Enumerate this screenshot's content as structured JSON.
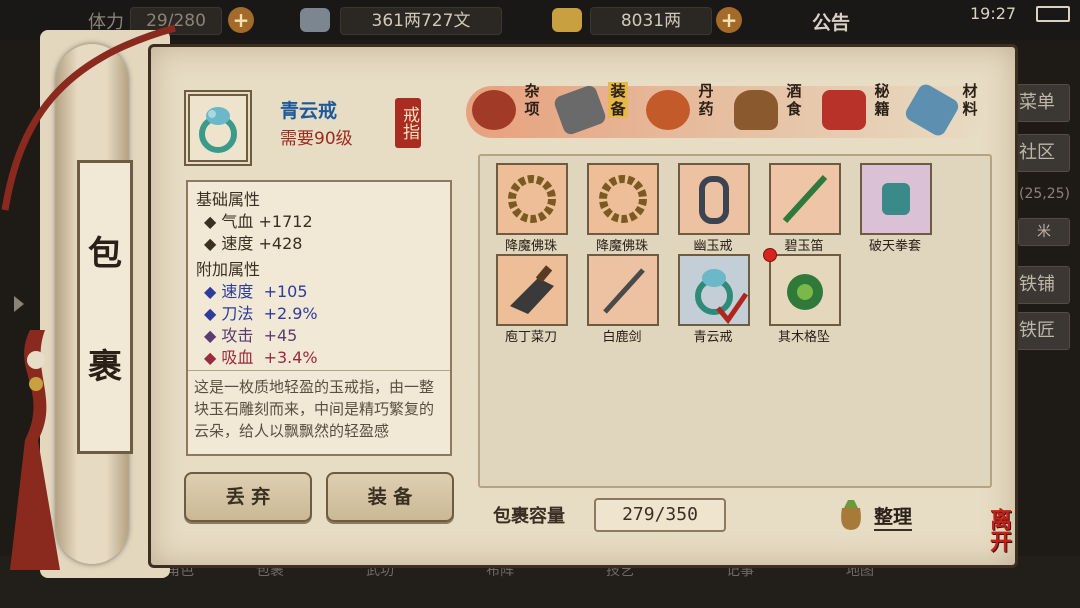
{
  "topbar": {
    "stamina": "29/280",
    "money_silver": "361两727文",
    "gold": "8031两",
    "notice": "公告",
    "time": "19:27"
  },
  "side_menu": [
    "菜单",
    "社区",
    "(25,25)",
    "米",
    "铁铺",
    "铁匠"
  ],
  "bottom_bar": [
    "角色",
    "包裹",
    "武功",
    "布阵",
    "技艺",
    "记事",
    "",
    "地图",
    ""
  ],
  "scroll_title": [
    "包",
    "裹"
  ],
  "selected_item": {
    "name": "青云戒",
    "requirement": "需要90级",
    "type_stamp": "戒指",
    "base_title": "基础属性",
    "base_attrs": [
      {
        "label": "气血",
        "value": "+1712"
      },
      {
        "label": "速度",
        "value": "+428"
      }
    ],
    "extra_title": "附加属性",
    "extra_attrs": [
      {
        "label": "速度",
        "value": "+105",
        "color": "#2d3c9a"
      },
      {
        "label": "刀法",
        "value": "+2.9%",
        "color": "#2d3c9a"
      },
      {
        "label": "攻击",
        "value": "+45",
        "color": "#5a3c72"
      },
      {
        "label": "吸血",
        "value": "+3.4%",
        "color": "#9a2b3e"
      }
    ],
    "description": "这是一枚质地轻盈的玉戒指，由一整块玉石雕刻而来，中间是精巧繁复的云朵，给人以飘飘然的轻盈感"
  },
  "buttons": {
    "discard": "丢 弃",
    "equip": "装 备",
    "sort": "整理"
  },
  "tabs": [
    {
      "label": "杂项",
      "color": "#a13a26"
    },
    {
      "label": "装备",
      "color": "#6a6a6a"
    },
    {
      "label": "丹药",
      "color": "#c25a2a"
    },
    {
      "label": "酒食",
      "color": "#8a5a2e"
    },
    {
      "label": "秘籍",
      "color": "#b8322a"
    },
    {
      "label": "材料",
      "color": "#5d8fb0"
    }
  ],
  "items": [
    {
      "name": "降魔佛珠",
      "color": "#7a5a20",
      "bg": "#e89a66"
    },
    {
      "name": "降魔佛珠",
      "color": "#7a5a20",
      "bg": "#e89a66"
    },
    {
      "name": "幽玉戒",
      "color": "#3b4450",
      "bg": "#e8a27a"
    },
    {
      "name": "碧玉笛",
      "color": "#2f7a3a",
      "bg": "#eaa882"
    },
    {
      "name": "破天拳套",
      "color": "#3a8a8a",
      "bg": "#c9a6d8"
    },
    {
      "name": "庖丁菜刀",
      "color": "#3a3a3a",
      "bg": "#e89a66"
    },
    {
      "name": "白鹿剑",
      "color": "#4a4a4a",
      "bg": "#e8a27a"
    },
    {
      "name": "青云戒",
      "color": "#2f8a7a",
      "bg": "#9ab8d8"
    },
    {
      "name": "其木格坠",
      "color": "#2f7a3a",
      "bg": "#d8c8a8"
    }
  ],
  "capacity": {
    "label": "包裹容量",
    "value": "279/350"
  },
  "close_label": "离开"
}
